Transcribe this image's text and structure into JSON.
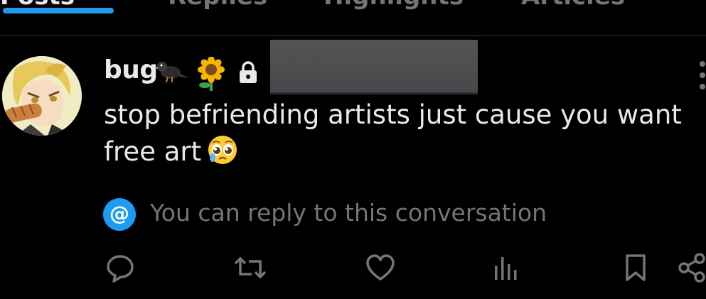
{
  "tabs": [
    {
      "label": "Posts"
    },
    {
      "label": "Replies"
    },
    {
      "label": "Highlights"
    },
    {
      "label": "Articles"
    }
  ],
  "post": {
    "author": "bug",
    "text_line1": "stop befriending artists just cause you want",
    "text_line2": "free art"
  },
  "reply_notice": {
    "text": "You can reply to this conversation"
  },
  "actions": [
    {
      "icon": "reply-icon"
    },
    {
      "icon": "repost-icon"
    },
    {
      "icon": "like-icon"
    },
    {
      "icon": "views-icon"
    },
    {
      "icon": "bookmark-icon"
    },
    {
      "icon": "share-icon"
    }
  ],
  "colors": {
    "accent": "#1d9bf0",
    "text": "#e7e9ea",
    "muted": "#71767b",
    "background": "#000000"
  }
}
